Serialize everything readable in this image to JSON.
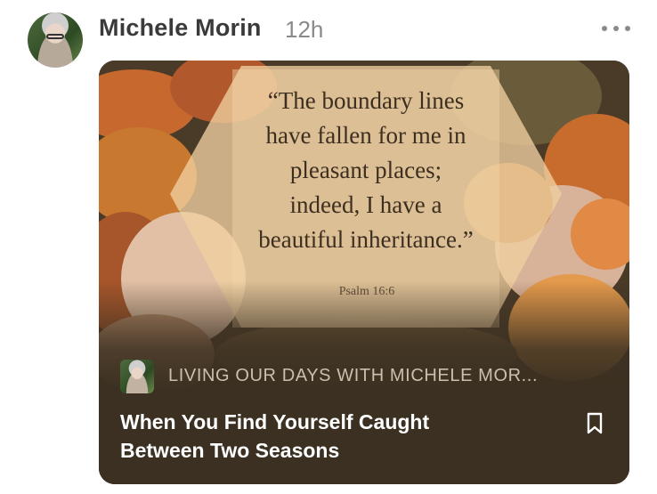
{
  "post": {
    "author": "Michele Morin",
    "time": "12h",
    "more_icon": "more-horizontal-icon"
  },
  "card": {
    "quote_lines": [
      "“The boundary lines",
      "have fallen for me in",
      "pleasant places;",
      "indeed, I have a",
      "beautiful inheritance.”"
    ],
    "quote_reference": "Psalm 16:6",
    "publication": "LIVING OUR DAYS WITH MICHELE MOR...",
    "title": "When You Find Yourself Caught Between Two Seasons",
    "bookmark_icon": "bookmark-icon",
    "colors": {
      "card_background": "#3b3021",
      "title": "#ffffff",
      "publication": "#cbbfae"
    }
  }
}
